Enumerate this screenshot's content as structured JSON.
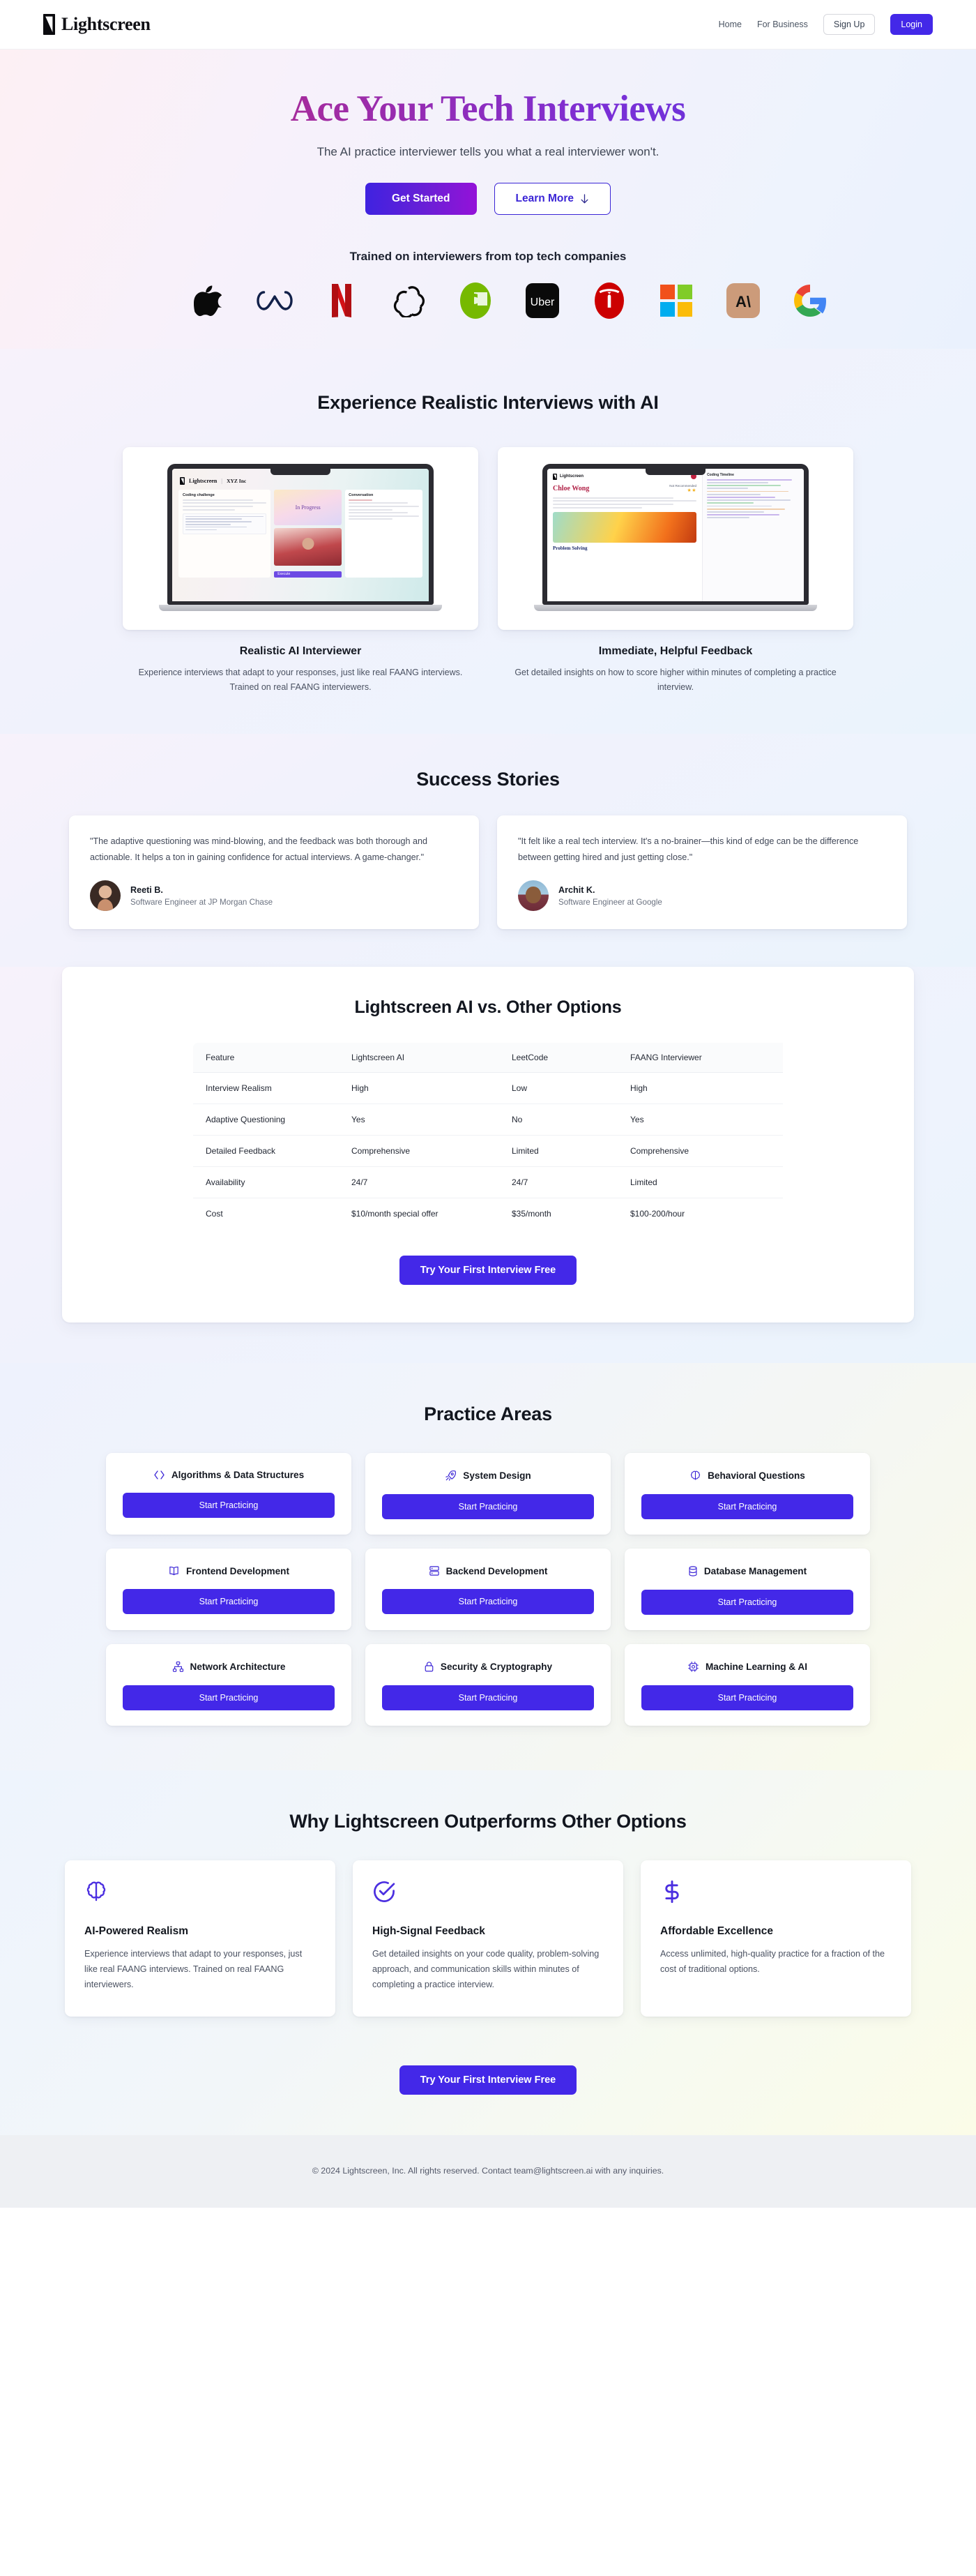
{
  "nav": {
    "brand": "Lightscreen",
    "links": [
      {
        "label": "Home",
        "name": "nav-link-home"
      },
      {
        "label": "For Business",
        "name": "nav-link-for-business"
      }
    ],
    "signup_label": "Sign Up",
    "login_label": "Login",
    "login_color": "#4328e8"
  },
  "hero": {
    "headline": "Ace Your Tech Interviews",
    "subheadline": "The AI practice interviewer tells you what a real interviewer won't.",
    "primary_cta": "Get Started",
    "secondary_cta": "Learn More",
    "secondary_cta_icon": "arrow-down-icon",
    "gradient_from": "#c22a5e",
    "gradient_to": "#4a3de2",
    "trusted_title": "Trained on interviewers from top tech companies",
    "logos": [
      {
        "name": "apple-logo",
        "label": "Apple"
      },
      {
        "name": "meta-logo",
        "label": "Meta"
      },
      {
        "name": "netflix-logo",
        "label": "Netflix"
      },
      {
        "name": "openai-logo",
        "label": "OpenAI"
      },
      {
        "name": "nvidia-logo",
        "label": "Nvidia"
      },
      {
        "name": "uber-logo",
        "label": "Uber"
      },
      {
        "name": "tesla-logo",
        "label": "Tesla"
      },
      {
        "name": "microsoft-logo",
        "label": "Microsoft"
      },
      {
        "name": "anthropic-logo",
        "label": "Anthropic"
      },
      {
        "name": "google-logo",
        "label": "Google"
      }
    ]
  },
  "experience": {
    "title": "Experience Realistic Interviews with AI",
    "cards": [
      {
        "title": "Realistic AI Interviewer",
        "body": "Experience interviews that adapt to your responses, just like real FAANG interviews. Trained on real FAANG interviewers.",
        "screen": {
          "brand": "Lightscreen",
          "divider": "|",
          "company": "XYZ Inc",
          "panel_title": "Coding challenge",
          "status": "In Progress",
          "button": "Execute",
          "right_title": "Conversation",
          "speaker": "Chloe"
        }
      },
      {
        "title": "Immediate, Helpful Feedback",
        "body": "Get detailed insights on how to score higher within minutes of completing a practice interview.",
        "screen": {
          "brand": "Lightscreen",
          "candidate": "Chloe Wong",
          "recommendation": "Not Recommended",
          "stars": "★★",
          "section": "Problem Solving",
          "code_title": "Coding Timeline"
        }
      }
    ]
  },
  "success": {
    "title": "Success Stories",
    "testimonials": [
      {
        "quote": "\"The adaptive questioning was mind-blowing, and the feedback was both thorough and actionable. It helps a ton in gaining confidence for actual interviews. A game-changer.\"",
        "name": "Reeti B.",
        "role": "Software Engineer at JP Morgan Chase"
      },
      {
        "quote": "\"It felt like a real tech interview. It's a no-brainer—this kind of edge can be the difference between getting hired and just getting close.\"",
        "name": "Archit K.",
        "role": "Software Engineer at Google"
      }
    ]
  },
  "compare": {
    "title": "Lightscreen AI vs. Other Options",
    "headers": [
      "Feature",
      "Lightscreen AI",
      "LeetCode",
      "FAANG Interviewer"
    ],
    "rows": [
      {
        "feature": "Interview Realism",
        "lightscreen": "High",
        "ls_tone": "good",
        "leetcode": "Low",
        "lc_tone": "bad",
        "faang": "High",
        "fa_tone": "good"
      },
      {
        "feature": "Adaptive Questioning",
        "lightscreen": "Yes",
        "ls_tone": "good",
        "leetcode": "No",
        "lc_tone": "bad",
        "faang": "Yes",
        "fa_tone": "good"
      },
      {
        "feature": "Detailed Feedback",
        "lightscreen": "Comprehensive",
        "ls_tone": "good",
        "leetcode": "Limited",
        "lc_tone": "warn",
        "faang": "Comprehensive",
        "fa_tone": "good"
      },
      {
        "feature": "Availability",
        "lightscreen": "24/7",
        "ls_tone": "good",
        "leetcode": "24/7",
        "lc_tone": "good",
        "faang": "Limited",
        "fa_tone": "bad"
      },
      {
        "feature": "Cost",
        "lightscreen": "$10/month special offer",
        "ls_tone": "good",
        "leetcode": "$35/month",
        "lc_tone": "warn",
        "faang": "$100-200/hour",
        "fa_tone": "bad"
      }
    ],
    "cta": "Try Your First Interview Free",
    "good_color": "#18a03d",
    "bad_color": "#dc2626",
    "warn_color": "#d79414"
  },
  "practice": {
    "title": "Practice Areas",
    "button_label": "Start Practicing",
    "items": [
      {
        "label": "Algorithms & Data Structures",
        "icon": "code-brackets-icon"
      },
      {
        "label": "System Design",
        "icon": "rocket-icon"
      },
      {
        "label": "Behavioral Questions",
        "icon": "brain-icon"
      },
      {
        "label": "Frontend Development",
        "icon": "book-open-icon"
      },
      {
        "label": "Backend Development",
        "icon": "server-icon"
      },
      {
        "label": "Database Management",
        "icon": "database-icon"
      },
      {
        "label": "Network Architecture",
        "icon": "network-icon"
      },
      {
        "label": "Security & Cryptography",
        "icon": "lock-icon"
      },
      {
        "label": "Machine Learning & AI",
        "icon": "chip-icon"
      }
    ]
  },
  "why": {
    "title": "Why Lightscreen Outperforms Other Options",
    "cards": [
      {
        "icon": "brain-icon",
        "title": "AI-Powered Realism",
        "body": "Experience interviews that adapt to your responses, just like real FAANG interviews. Trained on real FAANG interviewers."
      },
      {
        "icon": "check-circle-icon",
        "title": "High-Signal Feedback",
        "body": "Get detailed insights on your code quality, problem-solving approach, and communication skills within minutes of completing a practice interview."
      },
      {
        "icon": "dollar-icon",
        "title": "Affordable Excellence",
        "body": "Access unlimited, high-quality practice for a fraction of the cost of traditional options."
      }
    ],
    "cta": "Try Your First Interview Free"
  },
  "footer": {
    "text": "© 2024 Lightscreen, Inc. All rights reserved. Contact team@lightscreen.ai with any inquiries."
  }
}
